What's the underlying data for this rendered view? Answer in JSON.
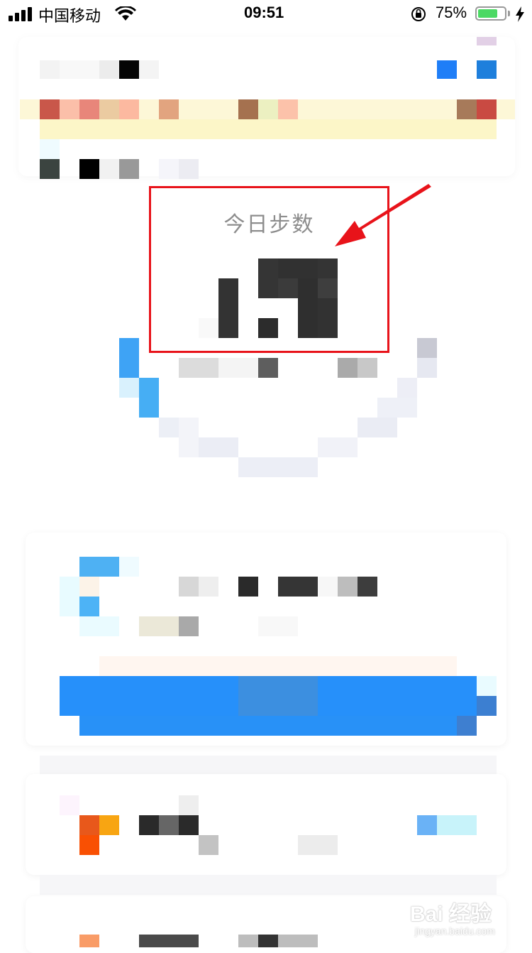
{
  "status_bar": {
    "carrier": "中国移动",
    "time": "09:51",
    "battery_percent": "75%",
    "battery_level": 0.75,
    "icons": [
      "signal-icon",
      "wifi-icon",
      "rotation-lock-icon",
      "battery-icon",
      "charging-icon"
    ]
  },
  "steps_card": {
    "title": "今日步数"
  },
  "annotation": {
    "box_color": "#e8131a",
    "arrow_color": "#e8131a"
  },
  "watermark": {
    "brand": "Bai 经验",
    "url": "jingyan.baidu.com"
  },
  "colors": {
    "accent_blue": "#2690fa",
    "highlight_red": "#e8131a"
  }
}
